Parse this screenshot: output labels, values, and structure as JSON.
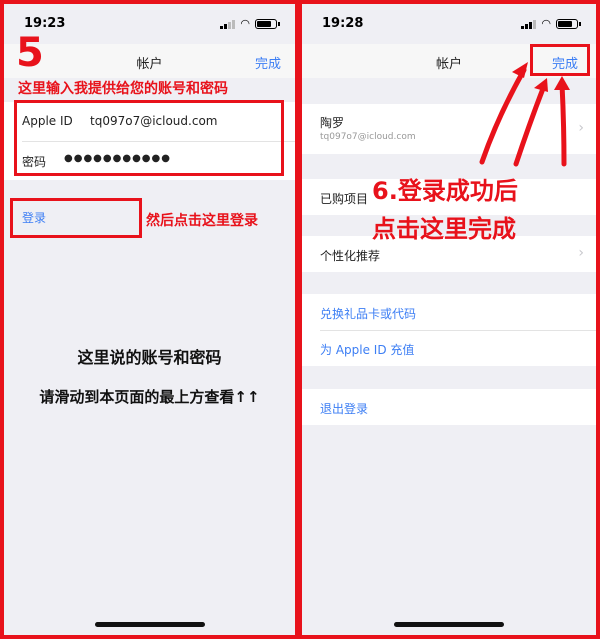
{
  "left": {
    "status": {
      "time": "19:23"
    },
    "nav": {
      "title": "帐户",
      "done": "完成"
    },
    "step_number": "5",
    "instruction_top": "这里输入我提供给您的账号和密码",
    "fields": {
      "apple_id_label": "Apple ID",
      "apple_id_value": "tq097o7@icloud.com",
      "password_label": "密码",
      "password_value": "●●●●●●●●●●●"
    },
    "login_label": "登录",
    "instruction_login": "然后点击这里登录",
    "note_line1": "这里说的账号和密码",
    "note_line2": "请滑动到本页面的最上方查看↑↑"
  },
  "right": {
    "status": {
      "time": "19:28"
    },
    "nav": {
      "title": "帐户",
      "done": "完成"
    },
    "account_name": "陶罗",
    "account_email": "tq097o7@icloud.com",
    "purchased": "已购项目",
    "personalized": "个性化推荐",
    "redeem": "兑换礼品卡或代码",
    "add_funds": "为 Apple ID 充值",
    "sign_out": "退出登录",
    "step_line1": "6.登录成功后",
    "step_line2": "点击这里完成"
  },
  "colors": {
    "annotation_red": "#e8121b",
    "ios_blue": "#3c7ef4"
  },
  "icons": [
    "location-arrow-icon",
    "signal-icon",
    "wifi-icon",
    "battery-icon",
    "chevron-right-icon"
  ]
}
